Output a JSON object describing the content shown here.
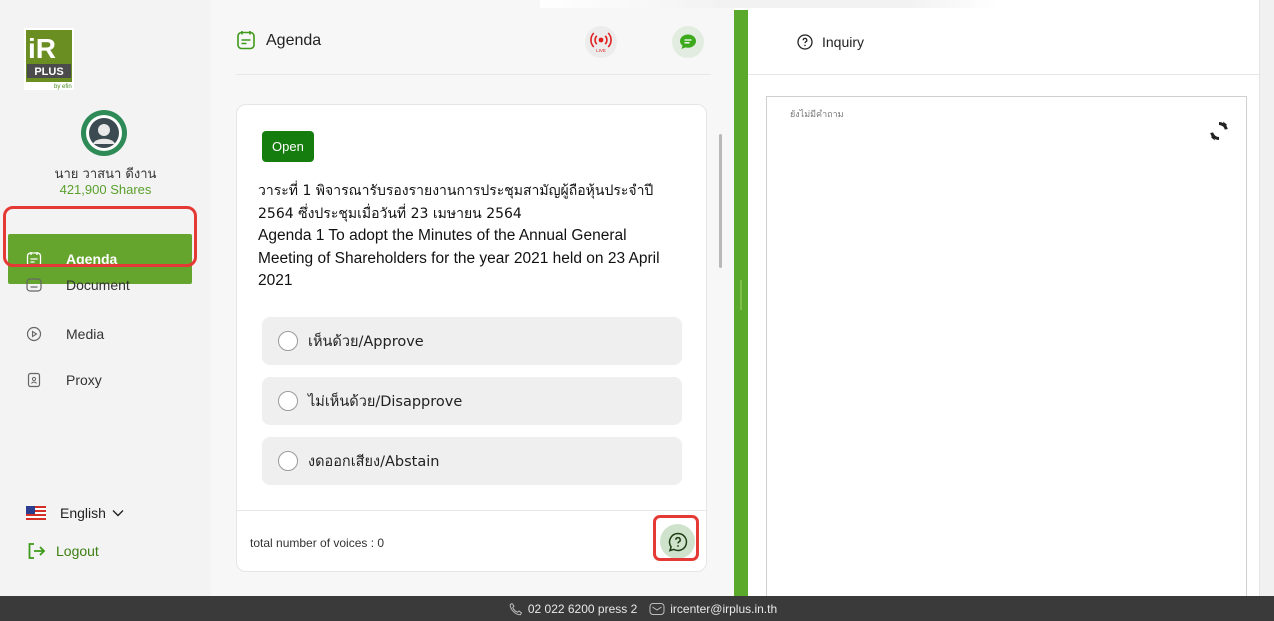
{
  "sidebar": {
    "logo_text": "IR PLUS",
    "logo_sub": "by efin",
    "user_name": "นาย วาสนา ดีงาน",
    "user_shares": "421,900 Shares",
    "items": [
      {
        "label": "Agenda",
        "icon": "agenda-icon",
        "active": true
      },
      {
        "label": "Document",
        "icon": "folder-icon"
      },
      {
        "label": "Media",
        "icon": "play-icon"
      },
      {
        "label": "Proxy",
        "icon": "proxy-file-icon"
      }
    ],
    "language": "English",
    "logout": "Logout"
  },
  "agenda_panel": {
    "title": "Agenda",
    "live_label": "LIVE",
    "card": {
      "status": "Open",
      "text_th": "วาระที่ 1 พิจารณารับรองรายงานการประชุมสามัญผู้ถือหุ้นประจำปี 2564 ซึ่งประชุมเมื่อวันที่ 23 เมษายน 2564",
      "text_en": "Agenda 1 To adopt the Minutes of the Annual General Meeting of Shareholders for the year 2021 held on 23 April 2021",
      "options": [
        {
          "label": "เห็นด้วย/Approve"
        },
        {
          "label": "ไม่เห็นด้วย/Disapprove"
        },
        {
          "label": "งดออกเสียง/Abstain"
        }
      ],
      "voices_label": "total number of voices : 0"
    }
  },
  "inquiry_panel": {
    "title": "Inquiry",
    "empty_text": "ยังไม่มีคำถาม"
  },
  "footer": {
    "phone": "02 022 6200 press 2",
    "email": "ircenter@irplus.in.th"
  },
  "colors": {
    "accent": "#65a42d",
    "badge": "#157d0d",
    "highlight": "#e53935",
    "footer": "#3a3a3a"
  }
}
